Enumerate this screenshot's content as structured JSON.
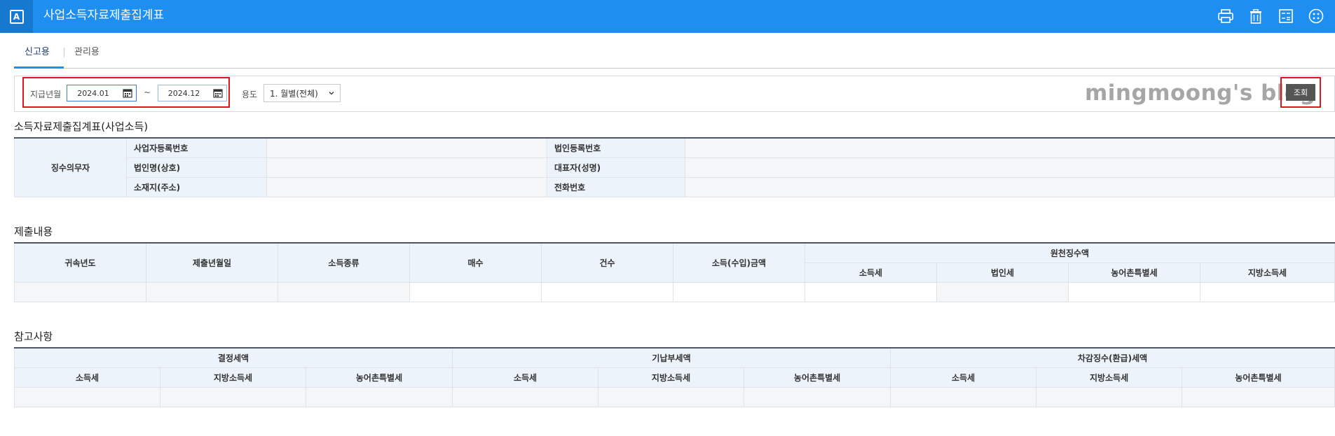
{
  "header": {
    "app_badge": "A",
    "title": "사업소득자료제출집계표",
    "icons": [
      "print-icon",
      "trash-icon",
      "calculator-icon",
      "grid-icon"
    ]
  },
  "tabs": [
    {
      "label": "신고용",
      "active": true
    },
    {
      "label": "관리용",
      "active": false
    }
  ],
  "search": {
    "period_label": "지급년월",
    "from": "2024.01",
    "tilde": "~",
    "to": "2024.12",
    "usage_label": "용도",
    "usage_value": "1. 월별(전체)",
    "watermark": "mingmoong's blog",
    "search_button": "조회"
  },
  "section1": {
    "title": "소득자료제출집계표(사업소득)",
    "group_label": "징수의무자",
    "row1_left": "사업자등록번호",
    "row1_right": "법인등록번호",
    "row2_left": "법인명(상호)",
    "row2_right": "대표자(성명)",
    "row3_left": "소재지(주소)",
    "row3_right": "전화번호"
  },
  "section2": {
    "title": "제출내용",
    "headers": [
      "귀속년도",
      "제출년월일",
      "소득종류",
      "매수",
      "건수",
      "소득(수입)금액"
    ],
    "group_header": "원천징수액",
    "sub_headers": [
      "소득세",
      "법인세",
      "농어촌특별세",
      "지방소득세"
    ]
  },
  "section3": {
    "title": "참고사항",
    "groups": [
      "결정세액",
      "기납부세액",
      "차감징수(환급)세액"
    ],
    "sub_headers": [
      "소득세",
      "지방소득세",
      "농어촌특별세"
    ]
  },
  "colors": {
    "topbar": "#1e8ff0",
    "header_cell": "#edf3fa",
    "highlight": "#e0161d"
  }
}
